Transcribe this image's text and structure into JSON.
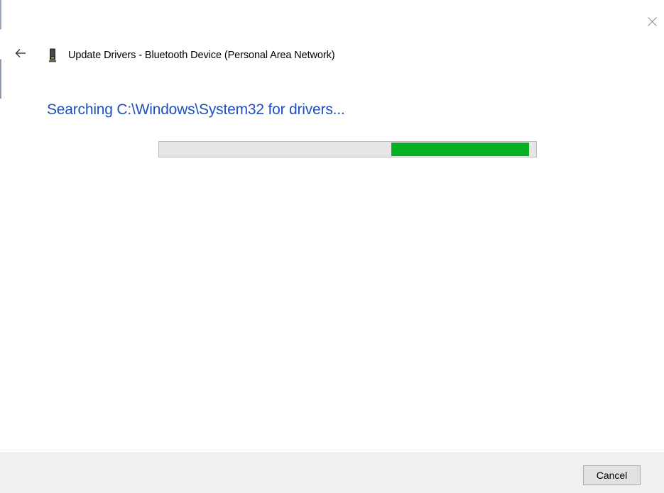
{
  "window": {
    "title": "Update Drivers - Bluetooth Device (Personal Area Network)",
    "device_icon": "bluetooth-device-icon"
  },
  "icons": {
    "back": "back-arrow-icon",
    "close": "close-icon"
  },
  "main": {
    "heading": "Searching C:\\Windows\\System32 for drivers...",
    "progress": {
      "style": "marquee",
      "segment_start_fraction": 0.615,
      "segment_end_fraction": 0.98,
      "color": "#06b025"
    }
  },
  "footer": {
    "cancel_label": "Cancel"
  },
  "colors": {
    "heading": "#1f4fbf",
    "progress_fill": "#06b025",
    "footer_bg": "#f0f0f0"
  }
}
